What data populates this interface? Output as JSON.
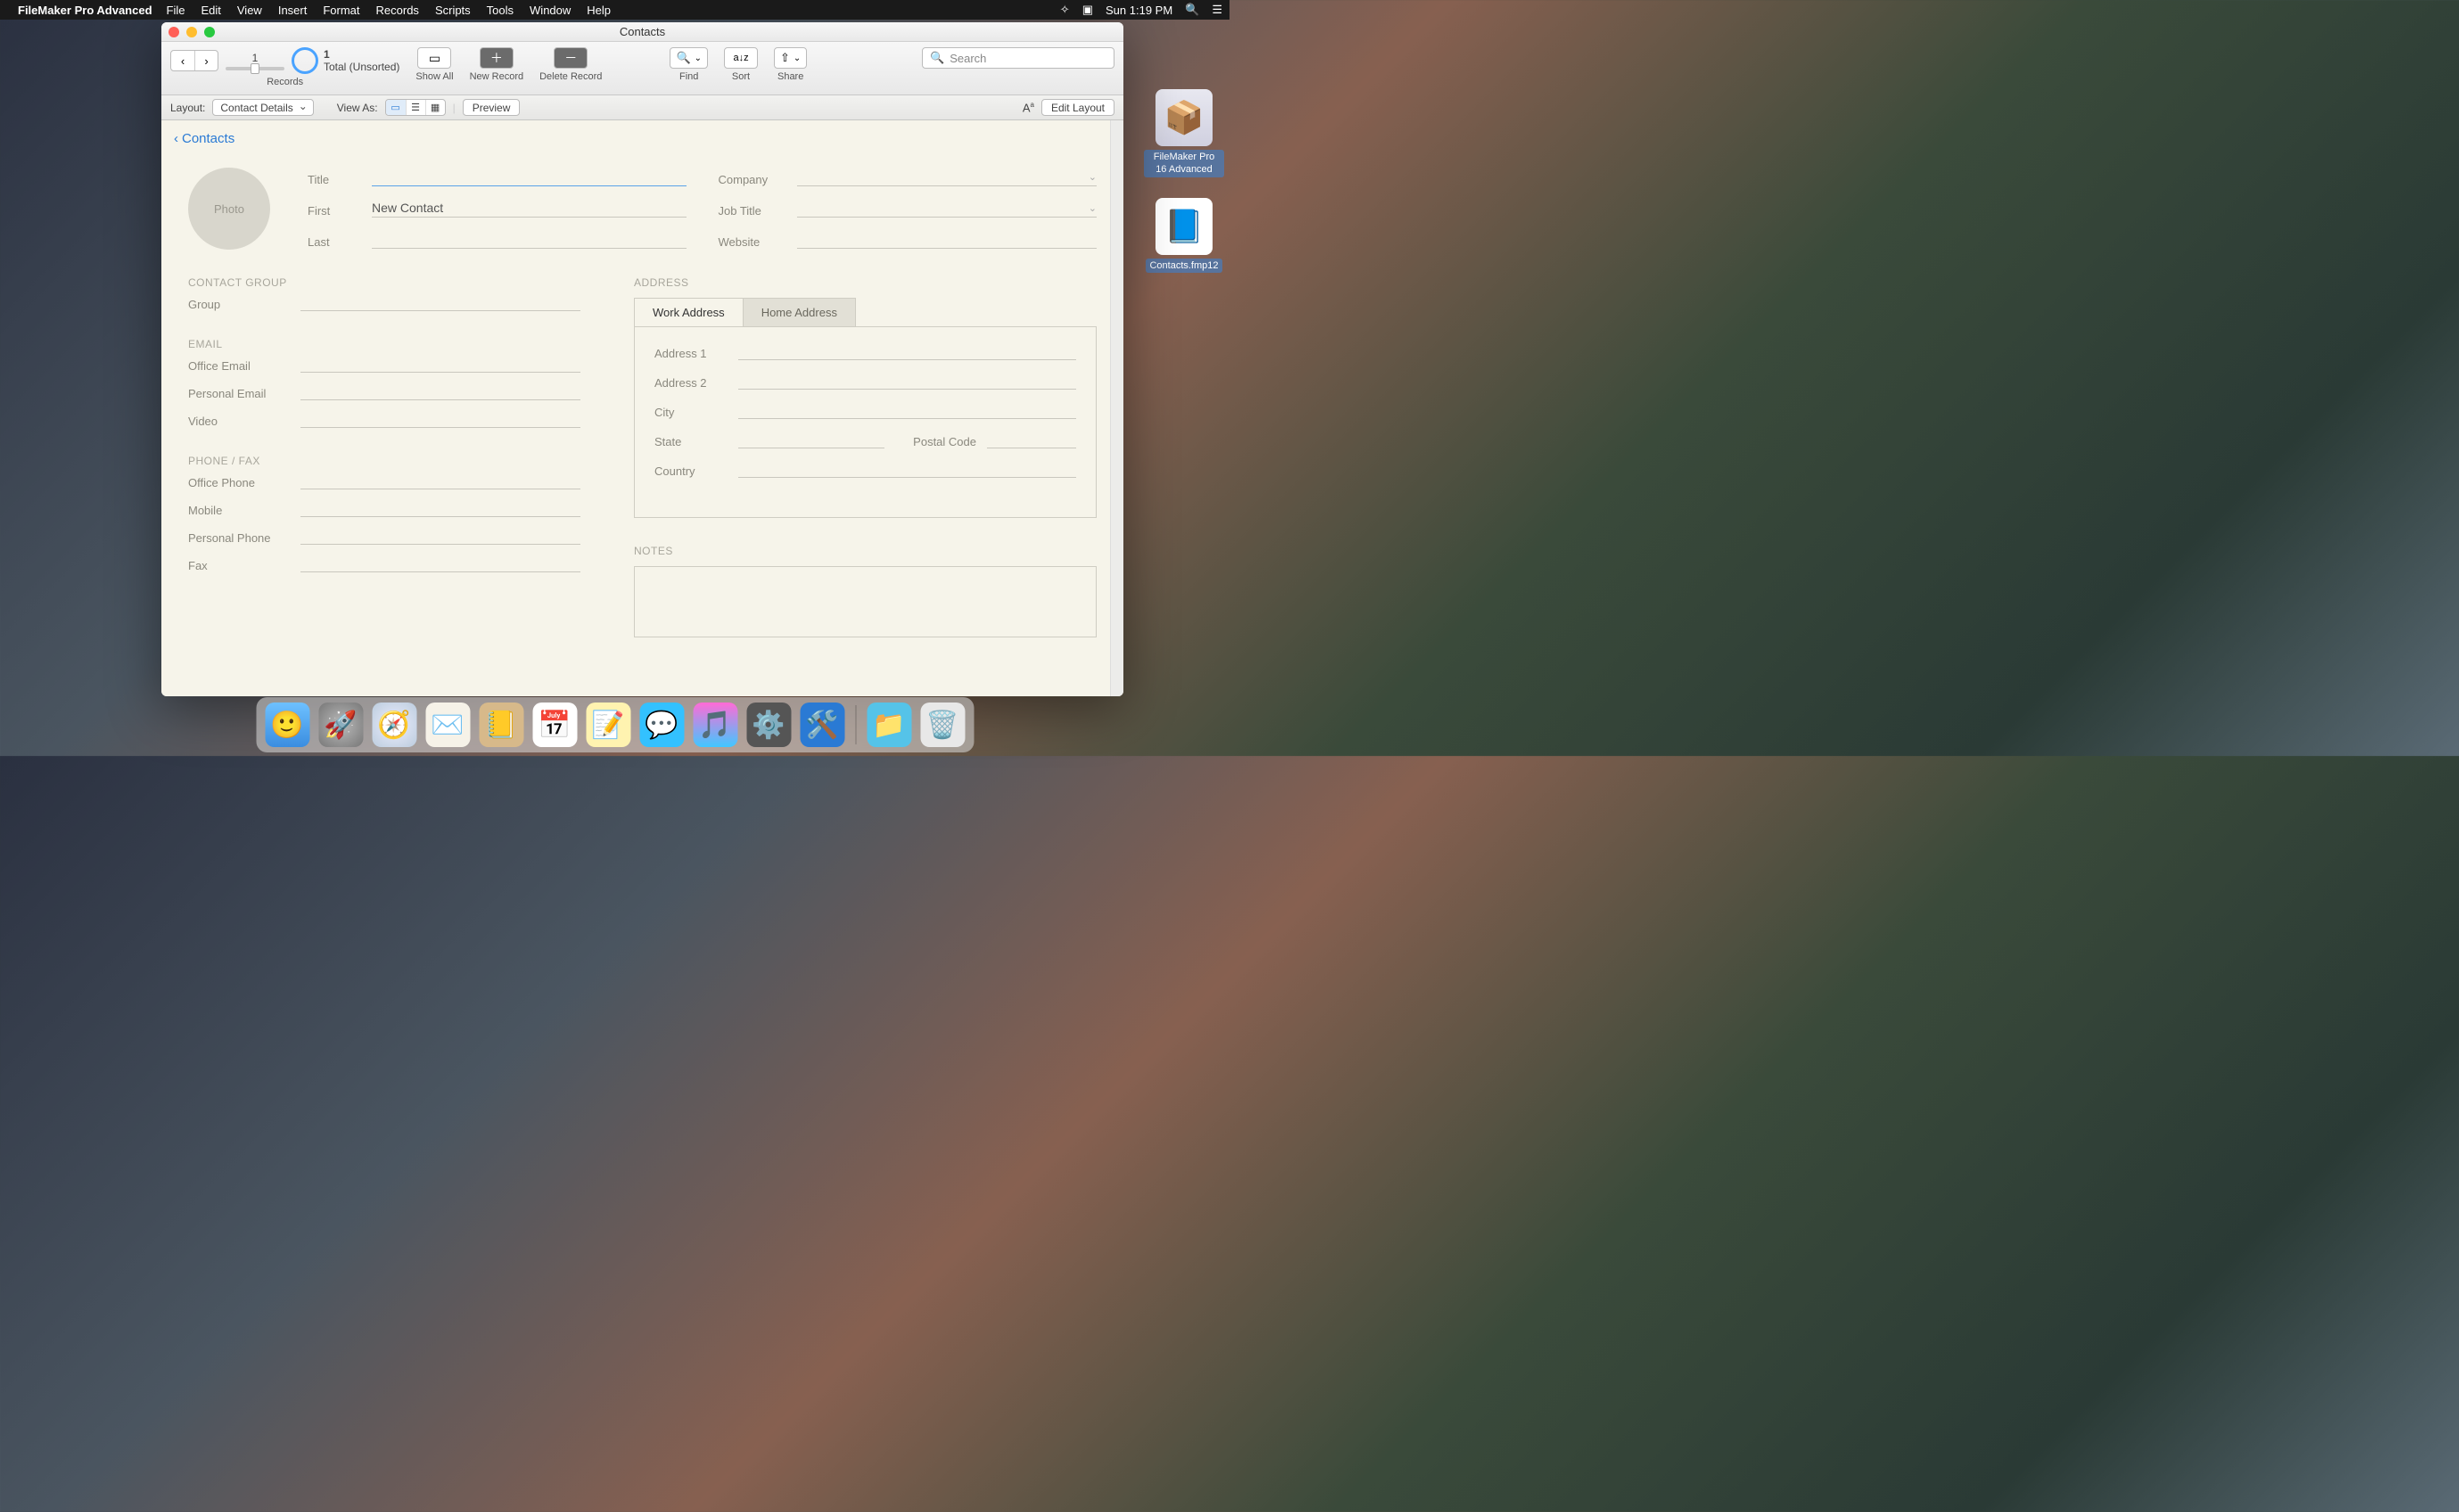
{
  "menubar": {
    "app": "FileMaker Pro Advanced",
    "items": [
      "File",
      "Edit",
      "View",
      "Insert",
      "Format",
      "Records",
      "Scripts",
      "Tools",
      "Window",
      "Help"
    ],
    "clock": "Sun 1:19 PM"
  },
  "desktop": {
    "icon1": "FileMaker Pro 16 Advanced",
    "icon2": "Contacts.fmp12"
  },
  "window": {
    "title": "Contacts",
    "toolbar": {
      "record_num": "1",
      "total_num": "1",
      "total_label": "Total (Unsorted)",
      "records_label": "Records",
      "show_all": "Show All",
      "new_record": "New Record",
      "delete_record": "Delete Record",
      "find": "Find",
      "sort": "Sort",
      "share": "Share",
      "search_placeholder": "Search"
    },
    "statusbar": {
      "layout_label": "Layout:",
      "layout_value": "Contact Details",
      "view_as": "View As:",
      "preview": "Preview",
      "text_format": "Aa",
      "edit_layout": "Edit Layout"
    },
    "body": {
      "back": "Contacts",
      "photo": "Photo",
      "left_top": {
        "title": "Title",
        "first": "First",
        "first_value": "New Contact",
        "last": "Last"
      },
      "right_top": {
        "company": "Company",
        "job": "Job Title",
        "website": "Website"
      },
      "contact_group_hdr": "CONTACT GROUP",
      "group": "Group",
      "email_hdr": "EMAIL",
      "office_email": "Office Email",
      "personal_email": "Personal Email",
      "video": "Video",
      "phone_hdr": "PHONE / FAX",
      "office_phone": "Office Phone",
      "mobile": "Mobile",
      "personal_phone": "Personal Phone",
      "fax": "Fax",
      "address_hdr": "ADDRESS",
      "tab_work": "Work Address",
      "tab_home": "Home Address",
      "addr1": "Address 1",
      "addr2": "Address 2",
      "city": "City",
      "state": "State",
      "postal": "Postal Code",
      "country": "Country",
      "notes_hdr": "NOTES"
    }
  },
  "dock": {
    "items": [
      "finder",
      "launchpad",
      "safari",
      "mail",
      "contacts",
      "calendar",
      "notes",
      "messages",
      "itunes",
      "settings",
      "xcode"
    ],
    "right_items": [
      "downloads",
      "trash"
    ]
  }
}
